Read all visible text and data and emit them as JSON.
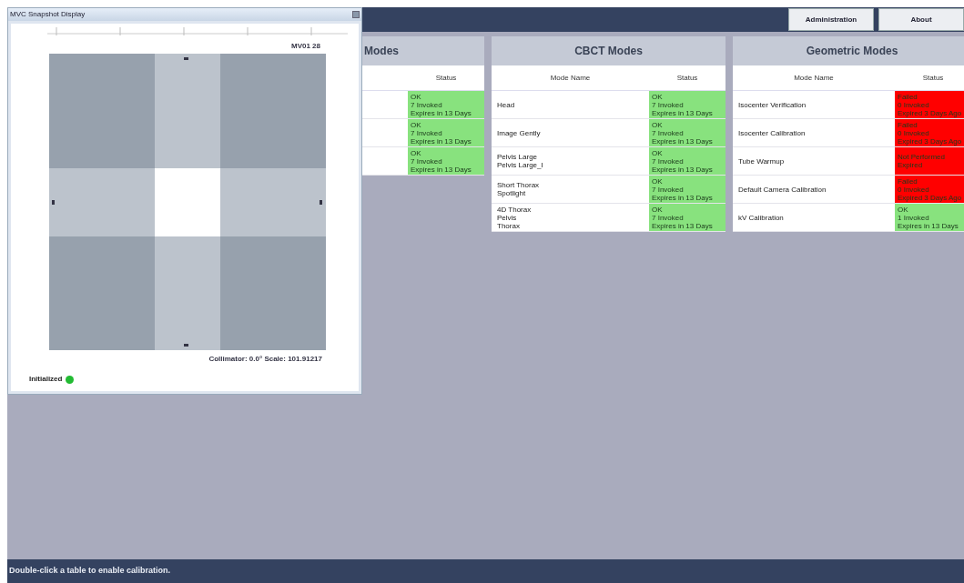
{
  "top_bar": {
    "buttons": [
      {
        "label": "Administration"
      },
      {
        "label": "About"
      }
    ]
  },
  "panels": [
    {
      "title": "Modes",
      "columns": [
        "Status"
      ],
      "rows": [
        {
          "name": [],
          "status": [
            "OK",
            "7 Invoked",
            "Expires in 13 Days"
          ],
          "color": "#88e27e"
        },
        {
          "name": [],
          "status": [
            "OK",
            "7 Invoked",
            "Expires in 13 Days"
          ],
          "color": "#88e27e"
        },
        {
          "name": [],
          "status": [
            "OK",
            "7 Invoked",
            "Expires in 13 Days"
          ],
          "color": "#88e27e"
        }
      ]
    },
    {
      "title": "CBCT Modes",
      "columns": [
        "Mode Name",
        "Status"
      ],
      "rows": [
        {
          "name": [
            "Head"
          ],
          "status": [
            "OK",
            "7 Invoked",
            "Expires in 13 Days"
          ],
          "color": "#88e27e"
        },
        {
          "name": [
            "Image Gently"
          ],
          "status": [
            "OK",
            "7 Invoked",
            "Expires in 13 Days"
          ],
          "color": "#88e27e"
        },
        {
          "name": [
            "Pelvis Large",
            "Pelvis Large_I"
          ],
          "status": [
            "OK",
            "7 Invoked",
            "Expires in 13 Days"
          ],
          "color": "#88e27e"
        },
        {
          "name": [
            "Short Thorax",
            "Spotlight"
          ],
          "status": [
            "OK",
            "7 Invoked",
            "Expires in 13 Days"
          ],
          "color": "#88e27e"
        },
        {
          "name": [
            "4D Thorax",
            "Pelvis",
            "Thorax"
          ],
          "status": [
            "OK",
            "7 Invoked",
            "Expires in 13 Days"
          ],
          "color": "#88e27e"
        }
      ]
    },
    {
      "title": "Geometric Modes",
      "columns": [
        "Mode Name",
        "Status"
      ],
      "rows": [
        {
          "name": [
            "Isocenter Verification"
          ],
          "status": [
            "Failed",
            "0 Invoked",
            "Expired 3 Days Ago"
          ],
          "color": "#ff0000"
        },
        {
          "name": [
            "Isocenter Calibration"
          ],
          "status": [
            "Failed",
            "0 Invoked",
            "Expired 3 Days Ago"
          ],
          "color": "#ff0000"
        },
        {
          "name": [
            "Tube Warmup"
          ],
          "status": [
            "Not Performed",
            "Expired"
          ],
          "color": "#ff0000"
        },
        {
          "name": [
            "Default Camera Calibration"
          ],
          "status": [
            "Failed",
            "0 Invoked",
            "Expired 3 Days Ago"
          ],
          "color": "#ff0000"
        },
        {
          "name": [
            "kV Calibration"
          ],
          "status": [
            "OK",
            "1 Invoked",
            "Expires in 13 Days"
          ],
          "color": "#88e27e"
        }
      ]
    }
  ],
  "snapshot_window": {
    "title": "MVC Snapshot Display",
    "image_label": "MV01 28",
    "caption": "Collimator: 0.0°  Scale: 101.91217",
    "state": {
      "label": "Initialized",
      "color": "#22bb33"
    }
  },
  "status_bar": "Double-click a table to enable calibration."
}
